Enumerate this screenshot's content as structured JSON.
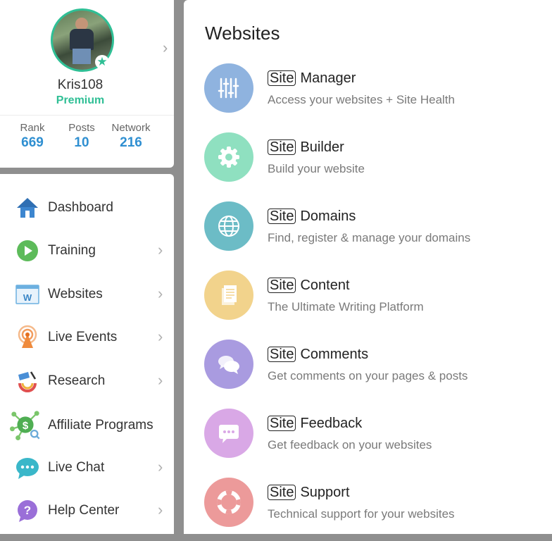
{
  "profile": {
    "username": "Kris108",
    "membership": "Premium",
    "stats": [
      {
        "label": "Rank",
        "value": "669"
      },
      {
        "label": "Posts",
        "value": "10"
      },
      {
        "label": "Network",
        "value": "216"
      }
    ]
  },
  "nav": {
    "active": "Websites",
    "items": [
      {
        "label": "Dashboard",
        "icon": "home-icon",
        "has_chevron": false
      },
      {
        "label": "Training",
        "icon": "play-icon",
        "has_chevron": true
      },
      {
        "label": "Websites",
        "icon": "website-icon",
        "has_chevron": true
      },
      {
        "label": "Live Events",
        "icon": "broadcast-icon",
        "has_chevron": true
      },
      {
        "label": "Research",
        "icon": "research-icon",
        "has_chevron": true
      },
      {
        "label": "Affiliate Programs",
        "icon": "affiliate-icon",
        "has_chevron": false
      },
      {
        "label": "Live Chat",
        "icon": "chat-icon",
        "has_chevron": true
      },
      {
        "label": "Help Center",
        "icon": "help-icon",
        "has_chevron": true
      }
    ]
  },
  "panel": {
    "title": "Websites",
    "badge": "Site",
    "items": [
      {
        "name": "Manager",
        "description": "Access your websites + Site Health",
        "icon": "sliders-icon",
        "color": "#8fb3df"
      },
      {
        "name": "Builder",
        "description": "Build your website",
        "icon": "gear-icon",
        "color": "#8fe0c0"
      },
      {
        "name": "Domains",
        "description": "Find, register & manage your domains",
        "icon": "globe-icon",
        "color": "#6cbcc6"
      },
      {
        "name": "Content",
        "description": "The Ultimate Writing Platform",
        "icon": "document-icon",
        "color": "#f2d38c"
      },
      {
        "name": "Comments",
        "description": "Get comments on your pages & posts",
        "icon": "comments-icon",
        "color": "#a99be0"
      },
      {
        "name": "Feedback",
        "description": "Get feedback on your websites",
        "icon": "feedback-icon",
        "color": "#d9a8e6"
      },
      {
        "name": "Support",
        "description": "Technical support for your websites",
        "icon": "lifebuoy-icon",
        "color": "#ec9a9a"
      }
    ]
  }
}
